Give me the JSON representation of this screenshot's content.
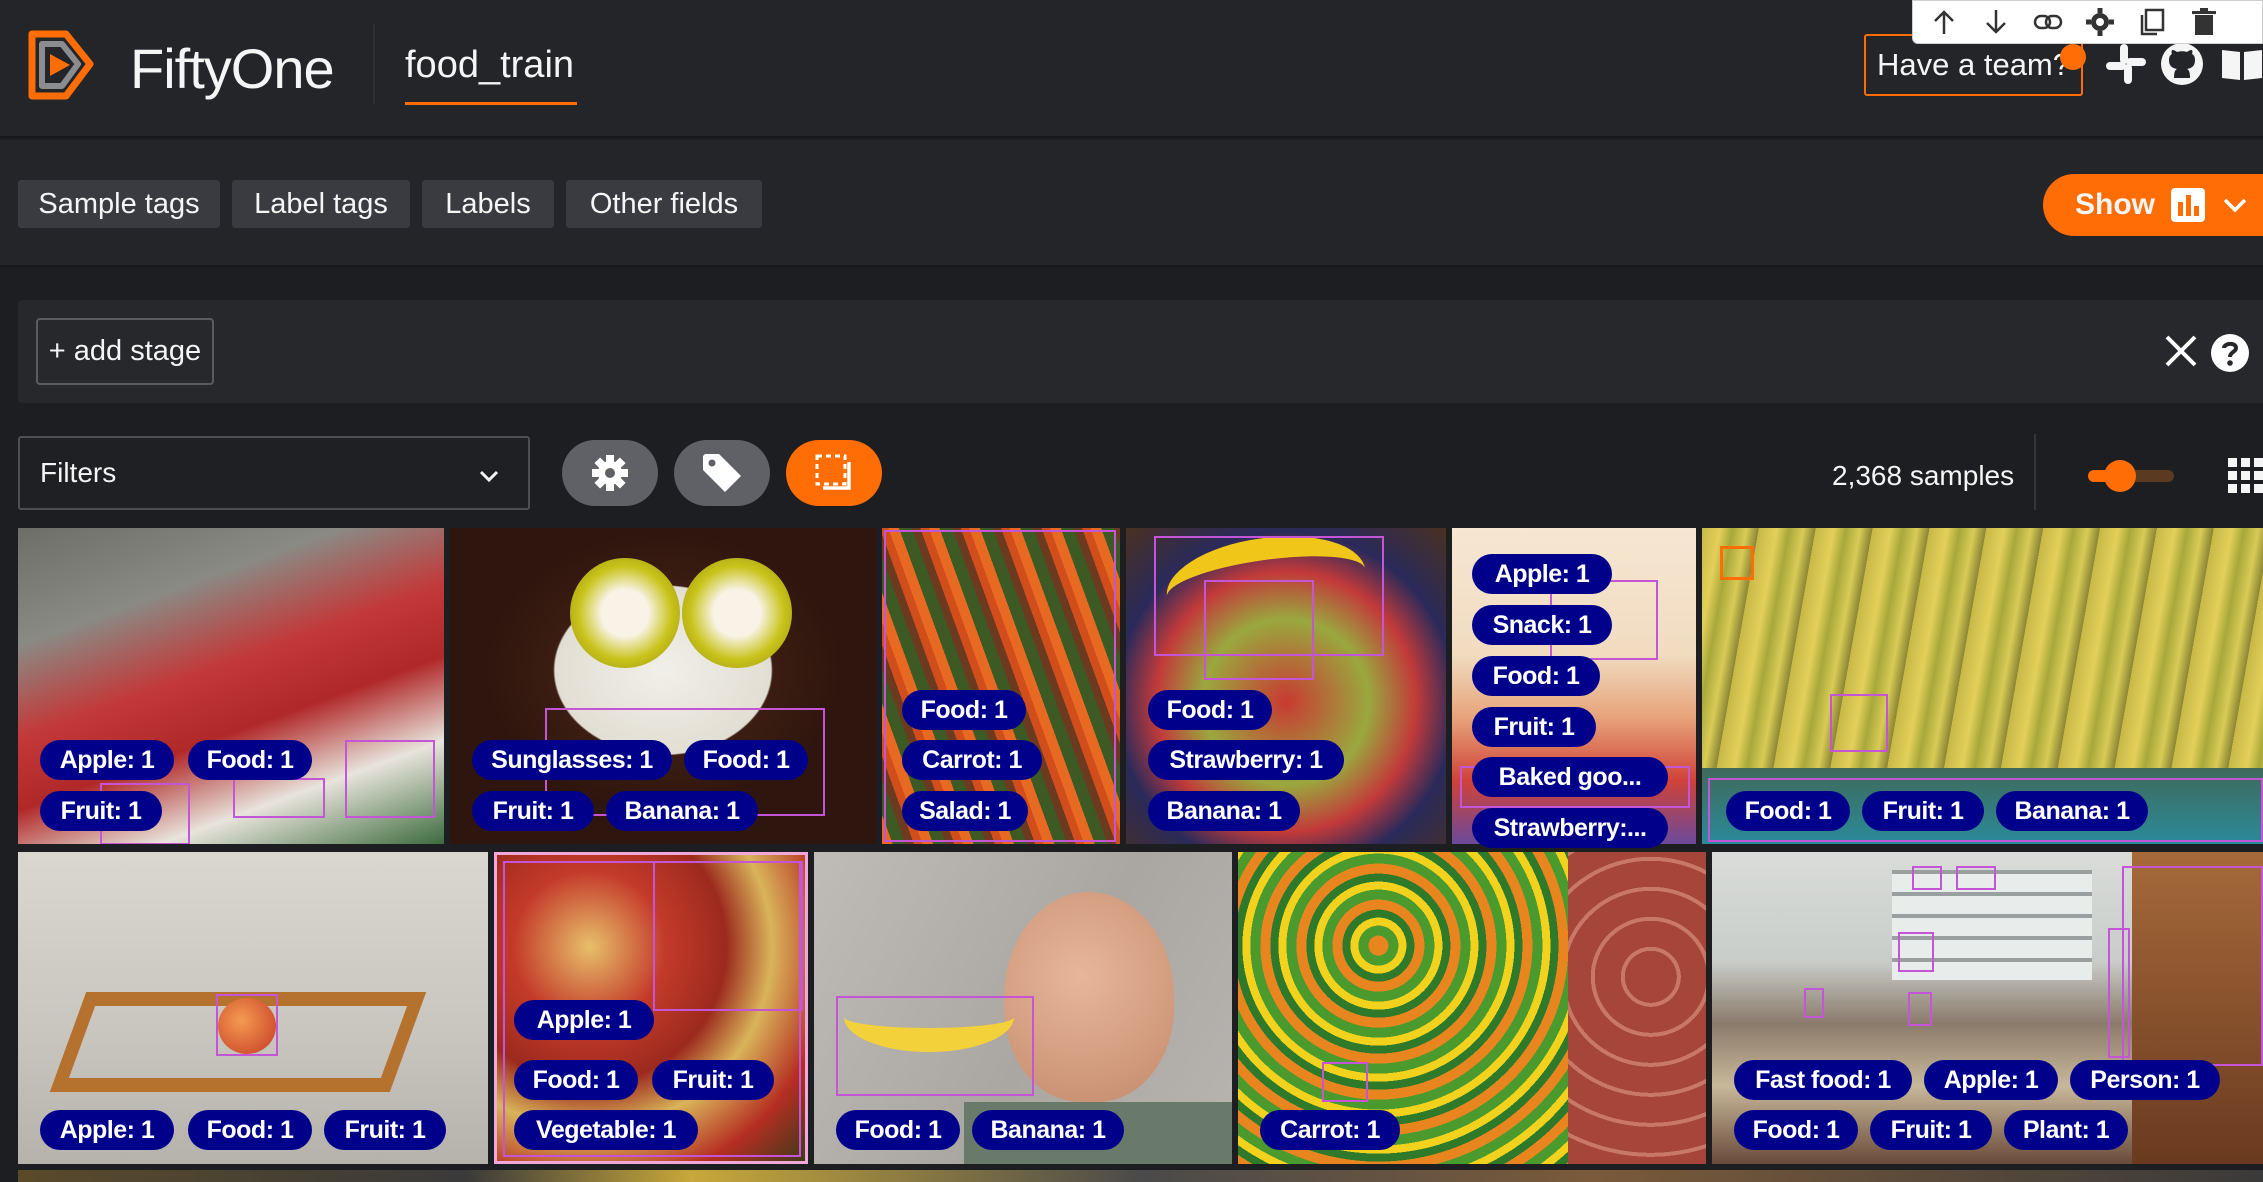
{
  "header": {
    "app_name": "FiftyOne",
    "dataset_name": "food_train",
    "team_button": "Have a team?",
    "icons": [
      "slack-icon",
      "github-icon",
      "docs-icon"
    ],
    "accent": "#ff6d04"
  },
  "floating_toolbar": {
    "icons": [
      "arrow-up-icon",
      "arrow-down-icon",
      "link-icon",
      "gear-icon",
      "copy-icon",
      "trash-icon"
    ]
  },
  "field_tabs": [
    "Sample tags",
    "Label tags",
    "Labels",
    "Other fields"
  ],
  "show_button": "Show",
  "view_bar": {
    "add_stage": "+ add stage"
  },
  "toolbar": {
    "filters_label": "Filters",
    "samples_count": "2,368 samples"
  },
  "grid": {
    "tiles": [
      {
        "labels": [
          "Apple: 1",
          "Food: 1",
          "Fruit: 1"
        ]
      },
      {
        "labels": [
          "Sunglasses: 1",
          "Food: 1",
          "Fruit: 1",
          "Banana: 1"
        ]
      },
      {
        "labels": [
          "Food: 1",
          "Carrot: 1",
          "Salad: 1"
        ]
      },
      {
        "labels": [
          "Food: 1",
          "Strawberry: 1",
          "Banana: 1"
        ]
      },
      {
        "labels": [
          "Apple: 1",
          "Snack: 1",
          "Food: 1",
          "Fruit: 1",
          "Baked goo...",
          "Strawberry:..."
        ]
      },
      {
        "labels": [
          "Food: 1",
          "Fruit: 1",
          "Banana: 1"
        ]
      },
      {
        "labels": [
          "Apple: 1",
          "Food: 1",
          "Fruit: 1"
        ]
      },
      {
        "labels": [
          "Apple: 1",
          "Food: 1",
          "Fruit: 1",
          "Vegetable: 1"
        ]
      },
      {
        "labels": [
          "Food: 1",
          "Banana: 1"
        ]
      },
      {
        "labels": [
          "Carrot: 1"
        ]
      },
      {
        "labels": [
          "Fast food: 1",
          "Apple: 1",
          "Person: 1",
          "Food: 1",
          "Fruit: 1",
          "Plant: 1"
        ]
      }
    ]
  }
}
